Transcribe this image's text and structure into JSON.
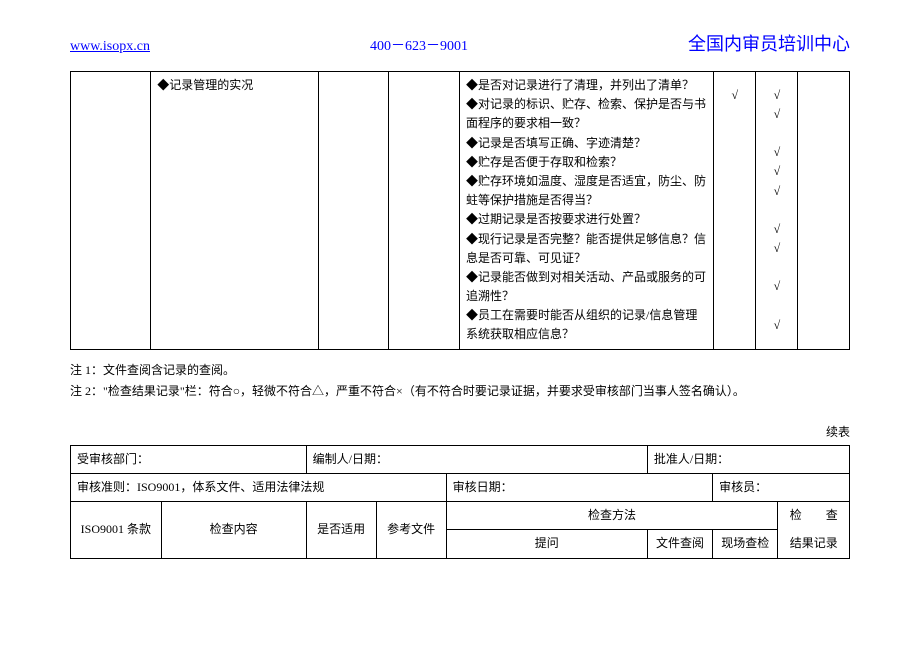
{
  "header": {
    "url": "www.isopx.cn",
    "phone": "400－623－9001",
    "title": "全国内审员培训中心"
  },
  "table1": {
    "col2": "◆记录管理的实况",
    "questions": [
      "◆是否对记录进行了清理，并列出了清单？",
      "◆对记录的标识、贮存、检索、保护是否与书面程序的要求相一致？",
      "◆记录是否填写正确、字迹清楚？",
      "◆贮存是否便于存取和检索？",
      "◆贮存环境如温度、湿度是否适宜，防尘、防蛀等保护措施是否得当？",
      "◆过期记录是否按要求进行处置？",
      "◆现行记录是否完整？能否提供足够信息？信息是否可靠、可见证？",
      "◆记录能否做到对相关活动、产品或服务的可追溯性？",
      "◆员工在需要时能否从组织的记录/信息管理系统获取相应信息？"
    ],
    "checks_col6": [
      "√",
      "",
      "",
      "",
      "",
      "",
      "",
      "",
      ""
    ],
    "checks_col7": [
      "√",
      "√",
      "√",
      "√",
      "√",
      "√",
      "√",
      "√",
      "√"
    ]
  },
  "notes": {
    "n1": "注 1：文件查阅含记录的查阅。",
    "n2": "注 2：\"检查结果记录\"栏：符合○，轻微不符合△，严重不符合×（有不符合时要记录证据，并要求受审核部门当事人签名确认）。"
  },
  "continued": "续表",
  "table2": {
    "r1c1": "受审核部门：",
    "r1c2": "编制人/日期：",
    "r1c3": "批准人/日期：",
    "r2c1": "审核准则：ISO9001，体系文件、适用法律法规",
    "r2c2": "审核日期：",
    "r2c3": "审核员：",
    "h_iso": "ISO9001 条款",
    "h_content": "检查内容",
    "h_apply": "是否适用",
    "h_ref": "参考文件",
    "h_method": "检查方法",
    "h_result_a": "检　　查",
    "h_result_b": "结果记录",
    "h_question": "提问",
    "h_doc": "文件查阅",
    "h_site": "现场查检"
  }
}
